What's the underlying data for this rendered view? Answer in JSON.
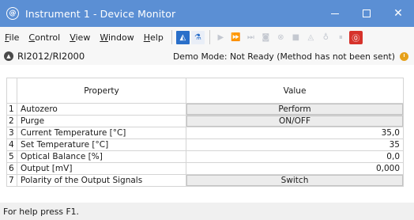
{
  "window": {
    "title": "Instrument 1 - Device Monitor",
    "app_icon_glyph": "@",
    "minimize_icon": "minimize-icon",
    "maximize_icon": "maximize-icon",
    "close_glyph": "✕"
  },
  "menu": {
    "items": [
      {
        "label": "File"
      },
      {
        "label": "Control"
      },
      {
        "label": "View"
      },
      {
        "label": "Window"
      },
      {
        "label": "Help"
      }
    ]
  },
  "toolbar": {
    "icons": [
      {
        "name": "instrument-blue-icon",
        "glyph": "◭",
        "state": "active"
      },
      {
        "name": "instrument-flask-icon",
        "glyph": "⚗",
        "state": "active"
      },
      {
        "name": "run-icon",
        "glyph": "▶",
        "state": "disabled"
      },
      {
        "name": "fast-forward-icon",
        "glyph": "⏩",
        "state": "disabled"
      },
      {
        "name": "step-icon",
        "glyph": "⏭",
        "state": "disabled"
      },
      {
        "name": "camera-icon",
        "glyph": "◙",
        "state": "disabled"
      },
      {
        "name": "cancel-icon",
        "glyph": "⊗",
        "state": "disabled"
      },
      {
        "name": "stop-square-icon",
        "glyph": "■",
        "state": "disabled"
      },
      {
        "name": "flask-icon",
        "glyph": "◬",
        "state": "disabled"
      },
      {
        "name": "lamp-icon",
        "glyph": "♁",
        "state": "disabled"
      },
      {
        "name": "pause-icon",
        "glyph": "⏸",
        "state": "disabled"
      },
      {
        "name": "emergency-stop-icon",
        "glyph": "⓪",
        "state": "alert"
      }
    ]
  },
  "device": {
    "name": "RI2012/RI2000",
    "mode_text": "Demo Mode: Not Ready (Method has not been sent)",
    "chevron_glyph": "▲"
  },
  "table": {
    "headers": {
      "property": "Property",
      "value": "Value"
    },
    "rows": [
      {
        "idx": "1",
        "property": "Autozero",
        "value": "Perform",
        "kind": "button"
      },
      {
        "idx": "2",
        "property": "Purge",
        "value": "ON/OFF",
        "kind": "button"
      },
      {
        "idx": "3",
        "property": "Current Temperature [°C]",
        "value": "35,0",
        "kind": "value"
      },
      {
        "idx": "4",
        "property": "Set Temperature [°C]",
        "value": "35",
        "kind": "value"
      },
      {
        "idx": "5",
        "property": "Optical Balance [%]",
        "value": "0,0",
        "kind": "value"
      },
      {
        "idx": "6",
        "property": "Output [mV]",
        "value": "0,000",
        "kind": "value"
      },
      {
        "idx": "7",
        "property": "Polarity of the Output Signals",
        "value": "Switch",
        "kind": "button"
      }
    ]
  },
  "status": {
    "text": "For help press F1."
  },
  "colors": {
    "titlebar": "#5b8fd4",
    "accent_blue": "#2a6fc9",
    "stop_red": "#d6322b",
    "clock_orange": "#e6a11a"
  }
}
